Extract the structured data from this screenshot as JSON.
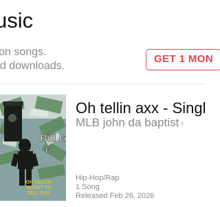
{
  "header": {
    "title": "usic"
  },
  "promo": {
    "line1": "lion songs.",
    "line2": "ed downloads.",
    "button_label": "GET 1 MON"
  },
  "album": {
    "title": "Oh tellin axx - Singl",
    "artist": "MLB john da baptist",
    "genre": "Hip-Hop/Rap",
    "song_count": "1 Song",
    "released": "Released Feb 26, 2026",
    "cover_text": {
      "name": "Bill G",
      "line1": "OH TELLIN",
      "line2": "ACCNT TO",
      "line3": "TELL THIS"
    }
  },
  "colors": {
    "accent": "#e8434d",
    "secondary_text": "#8a8a8e",
    "primary_text": "#111111"
  },
  "icons": {
    "artist_chevron": "chevron-right-icon"
  }
}
